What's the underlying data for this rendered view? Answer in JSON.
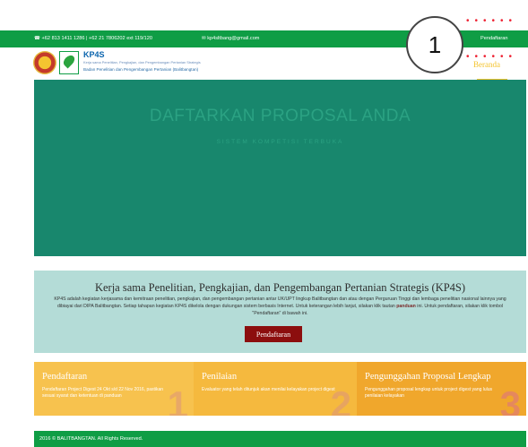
{
  "topbar": {
    "contact": "☎ +62 813 1411 1286 | +62 21 7806202 ext 119/120",
    "email": "✉ kp4sltbang@gmail.com",
    "nav_register": "Pendaftaran"
  },
  "header": {
    "brand": "KP4S",
    "brand_sub1": "Kerja sama Penelitian, Pengkajian, dan Pengembangan Pertanian Strategis",
    "brand_sub2": "Badan Penelitian dan Pengembangan Pertanian (Balitbangtan)",
    "nav_home": "Beranda"
  },
  "hero": {
    "title": "DAFTARKAN PROPOSAL ANDA",
    "subtitle": "SISTEM KOMPETISI TERBUKA"
  },
  "callout": {
    "number": "1"
  },
  "info": {
    "title": "Kerja sama Penelitian, Pengkajian, dan Pengembangan Pertanian Strategis (KP4S)",
    "body_1": "KP4S adalah kegiatan kerjasama dan kemitraan penelitian, pengkajian, dan pengembangan pertanian antar UK/UPT lingkup Balitbangtan dan atau dengan Perguruan Tinggi dan lembaga penelitian nasional lainnya yang dibiayai dari DIPA Balitbangtan. Setiap tahapan kegiatan KP4S dikelola dengan dukungan sistem berbasis Internet. Untuk keterangan lebih lanjut, silakan klik tautan ",
    "body_link": "panduan",
    "body_2": " ini. Untuk pendaftaran, silakan klik tombol \"Pendaftaran\" di bawah ini.",
    "button": "Pendaftaran"
  },
  "steps": [
    {
      "title": "Pendaftaran",
      "text": "Pendaftaran Project Digest 24 Okt s/d 22 Nov 2016, pastikan sesuai syarat dan ketentuan di panduan",
      "num": "1"
    },
    {
      "title": "Penilaian",
      "text": "Evaluator yang telah ditunjuk akan menilai kelayakan project digest",
      "num": "2"
    },
    {
      "title": "Pengunggahan Proposal Lengkap",
      "text": "Pengunggahan proposal lengkap untuk project digest yang lulus penilaian kelayakan",
      "num": "3"
    }
  ],
  "footer": {
    "copyright": "2016 © BALITBANGTAN. All Rights Reserved."
  }
}
